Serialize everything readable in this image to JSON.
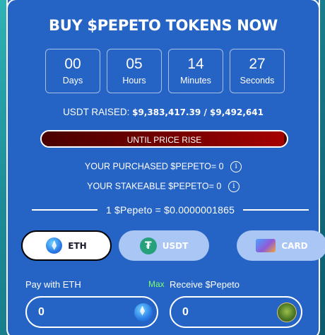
{
  "title": "BUY $PEPETO TOKENS NOW",
  "countdown": [
    {
      "value": "00",
      "label": "Days"
    },
    {
      "value": "05",
      "label": "Hours"
    },
    {
      "value": "14",
      "label": "Minutes"
    },
    {
      "value": "27",
      "label": "Seconds"
    }
  ],
  "raised": {
    "label": "USDT RAISED:",
    "amount": "$9,383,417.39 / $9,492,641"
  },
  "progress": {
    "label": "UNTIL PRICE RISE",
    "fraction": 0.988
  },
  "purchased": {
    "label": "YOUR PURCHASED $PEPETO= 0",
    "icon": "info-icon"
  },
  "stakeable": {
    "label": "YOUR STAKEABLE $PEPETO= 0",
    "icon": "info-icon"
  },
  "rate": "1 $Pepeto = $0.0000001865",
  "payment_methods": [
    {
      "label": "ETH",
      "icon": "eth-icon",
      "selected": true
    },
    {
      "label": "USDT",
      "icon": "usdt-icon",
      "selected": false
    },
    {
      "label": "CARD",
      "icon": "card-icon",
      "selected": false
    }
  ],
  "pay": {
    "label": "Pay with ETH",
    "max_label": "Max",
    "value": "0",
    "icon": "eth-icon"
  },
  "receive": {
    "label": "Receive $Pepeto",
    "value": "0",
    "icon": "pepe-icon"
  },
  "colors": {
    "card_bg": "#2563c4",
    "progress_fill": "#8b0000",
    "max": "#7dff6a",
    "usdt": "#26a17b"
  }
}
